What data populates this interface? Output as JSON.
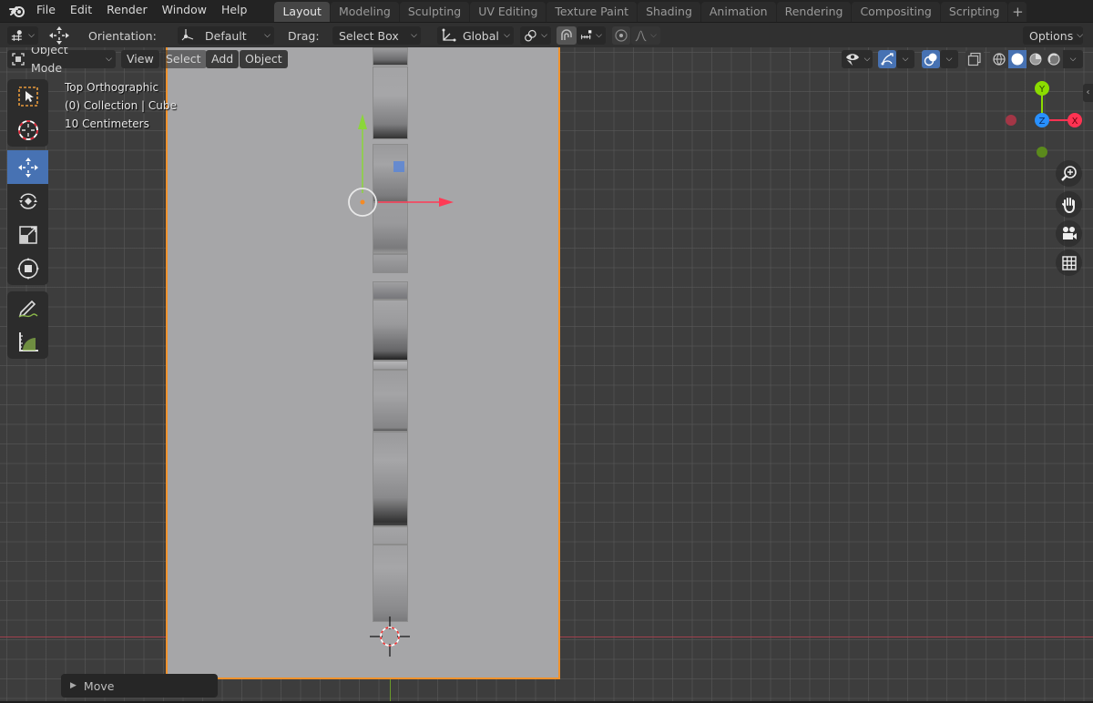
{
  "app": {
    "logo_icon": "blender-logo-icon",
    "menu": [
      "File",
      "Edit",
      "Render",
      "Window",
      "Help"
    ]
  },
  "workspaces": {
    "tabs": [
      "Layout",
      "Modeling",
      "Sculpting",
      "UV Editing",
      "Texture Paint",
      "Shading",
      "Animation",
      "Rendering",
      "Compositing",
      "Scripting"
    ],
    "active": "Layout",
    "add_label": "+"
  },
  "tool_header": {
    "orientation_label": "Orientation:",
    "orientation_value": "Default",
    "drag_label": "Drag:",
    "drag_value": "Select Box",
    "transform_orientation": "Global",
    "options_label": "Options"
  },
  "viewport_header": {
    "mode": "Object Mode",
    "menus": [
      "View",
      "Select",
      "Add",
      "Object"
    ]
  },
  "viewport_overlay": {
    "view_name": "Top Orthographic",
    "collection": "(0) Collection | Cube",
    "scale": "10 Centimeters"
  },
  "toolbar": {
    "tools": [
      {
        "name": "select-box",
        "icon": "select-box-icon"
      },
      {
        "name": "cursor",
        "icon": "cursor-icon"
      },
      {
        "name": "move",
        "icon": "move-icon",
        "active": true
      },
      {
        "name": "rotate",
        "icon": "rotate-icon"
      },
      {
        "name": "scale",
        "icon": "scale-icon"
      },
      {
        "name": "transform",
        "icon": "transform-icon"
      },
      {
        "name": "annotate",
        "icon": "annotate-icon"
      },
      {
        "name": "measure",
        "icon": "measure-icon"
      }
    ]
  },
  "gizmo": {
    "x_label": "X",
    "y_label": "Y",
    "z_label": "Z",
    "colors": {
      "x": "#ff3352",
      "y": "#8bdc00",
      "z": "#2890ff"
    }
  },
  "nav_buttons": [
    "zoom-icon",
    "hand-pan-icon",
    "camera-icon",
    "grid-ortho-icon"
  ],
  "last_operator": {
    "label": "Move"
  },
  "colors": {
    "accent": "#4772b3",
    "selection_outline": "#f0922c"
  }
}
